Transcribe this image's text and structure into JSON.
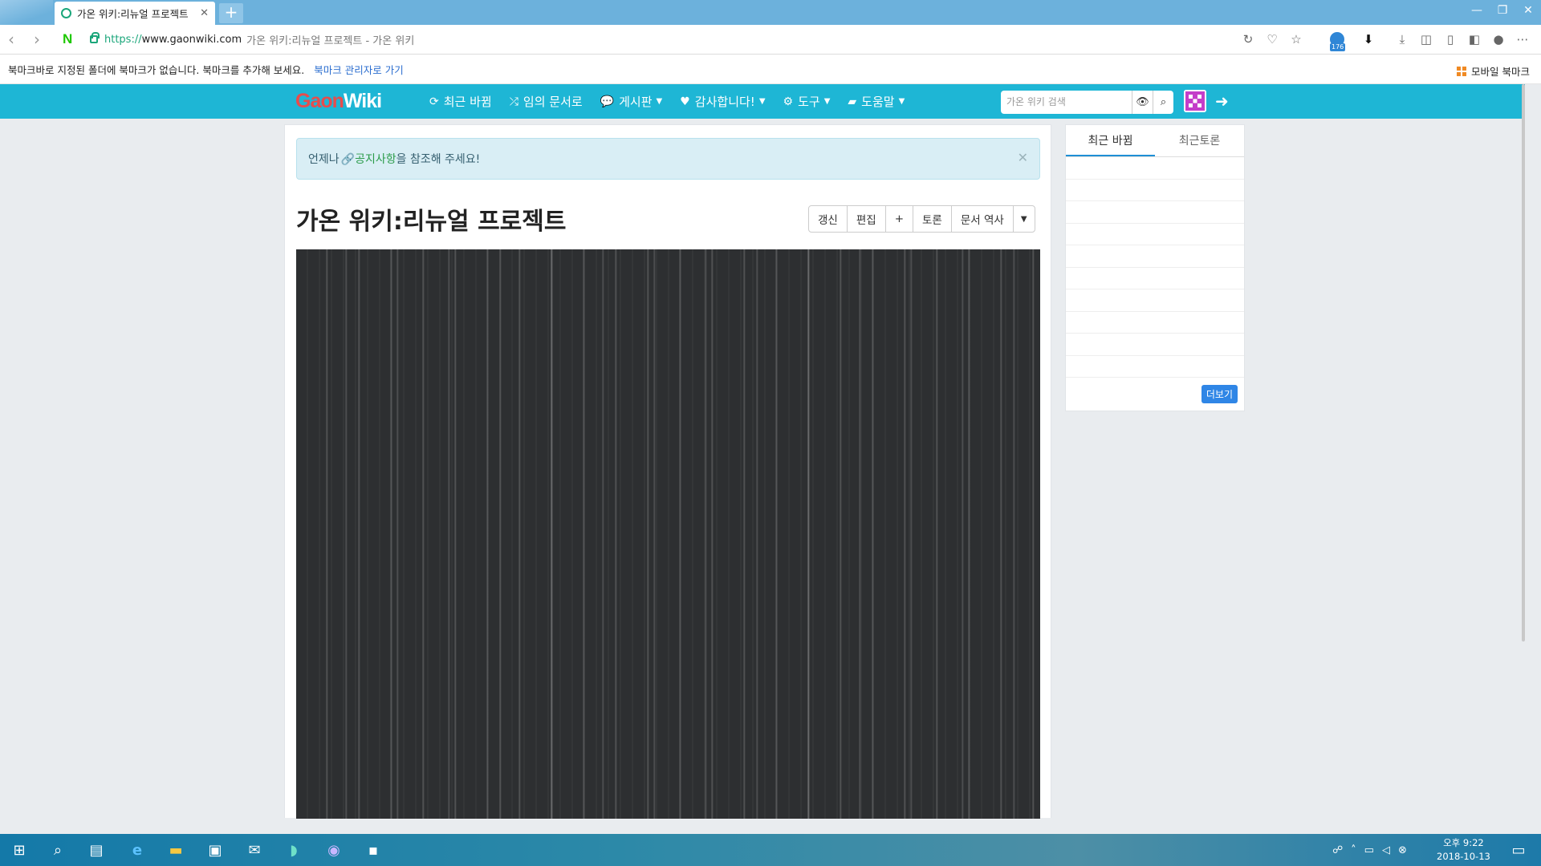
{
  "browser": {
    "tab_title": "가온 위키:리뉴얼 프로젝트",
    "url_scheme": "https://",
    "url_host": "www.gaonwiki.com",
    "page_title": "가온 위키:리뉴얼 프로젝트 - 가온 위키",
    "extension_badge": "176",
    "bookmark_message": "북마크바로 지정된 폴더에 북마크가 없습니다. 북마크를 추가해 보세요.",
    "bookmark_manager_link": "북마크 관리자로 가기",
    "mobile_bookmarks": "모바일 북마크"
  },
  "site": {
    "logo_gaon": "Gaon",
    "logo_wiki": "Wiki",
    "menu": [
      {
        "label": "최근 바뀜"
      },
      {
        "label": "임의 문서로"
      },
      {
        "label": "게시판"
      },
      {
        "label": "감사합니다!"
      },
      {
        "label": "도구"
      },
      {
        "label": "도움말"
      }
    ],
    "search_placeholder": "가온 위키 검색"
  },
  "notice": {
    "prefix": "언제나 ",
    "link": "공지사항",
    "suffix": "을 참조해 주세요!"
  },
  "article": {
    "title": "가온 위키:리뉴얼 프로젝트",
    "actions": [
      "갱신",
      "편집",
      "+",
      "토론",
      "문서 역사"
    ]
  },
  "sidebar": {
    "tabs": [
      "최근 바뀜",
      "최근토론"
    ],
    "more_label": "더보기"
  },
  "taskbar": {
    "time": "오후 9:22",
    "date": "2018-10-13"
  }
}
